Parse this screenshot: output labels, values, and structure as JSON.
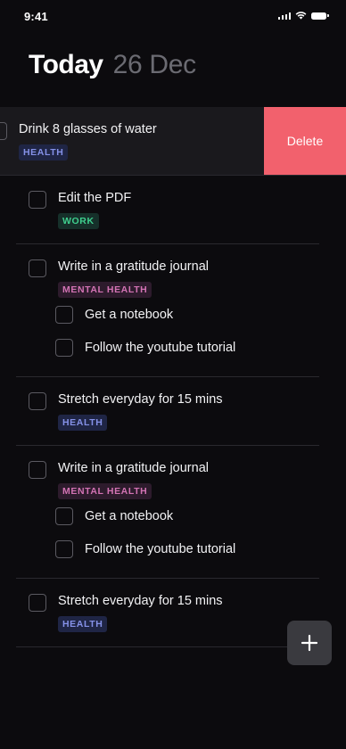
{
  "status_bar": {
    "time": "9:41",
    "icons": [
      "signal-icon",
      "wifi-icon",
      "battery-icon"
    ]
  },
  "header": {
    "title": "Today",
    "date": "26 Dec"
  },
  "swiped_task": {
    "title": "Drink 8 glasses of water",
    "tag": "HEALTH",
    "delete_label": "Delete"
  },
  "tasks": [
    {
      "title": "Edit the PDF",
      "tag": "WORK",
      "subtasks": []
    },
    {
      "title": "Write in a gratitude journal",
      "tag": "MENTAL HEALTH",
      "subtasks": [
        {
          "title": "Get a notebook"
        },
        {
          "title": "Follow the youtube tutorial"
        }
      ]
    },
    {
      "title": "Stretch everyday for 15 mins",
      "tag": "HEALTH",
      "subtasks": []
    },
    {
      "title": "Write in a gratitude journal",
      "tag": "MENTAL HEALTH",
      "subtasks": [
        {
          "title": "Get a notebook"
        },
        {
          "title": "Follow the youtube tutorial"
        }
      ]
    },
    {
      "title": "Stretch everyday for 15 mins",
      "tag": "HEALTH",
      "subtasks": []
    }
  ],
  "fab": {
    "icon": "plus-icon"
  },
  "colors": {
    "background": "#0c0b0e",
    "delete_action": "#f2616d",
    "tag_health": "#8591e8",
    "tag_work": "#3fcf8e",
    "tag_mental_health": "#d373b4"
  }
}
